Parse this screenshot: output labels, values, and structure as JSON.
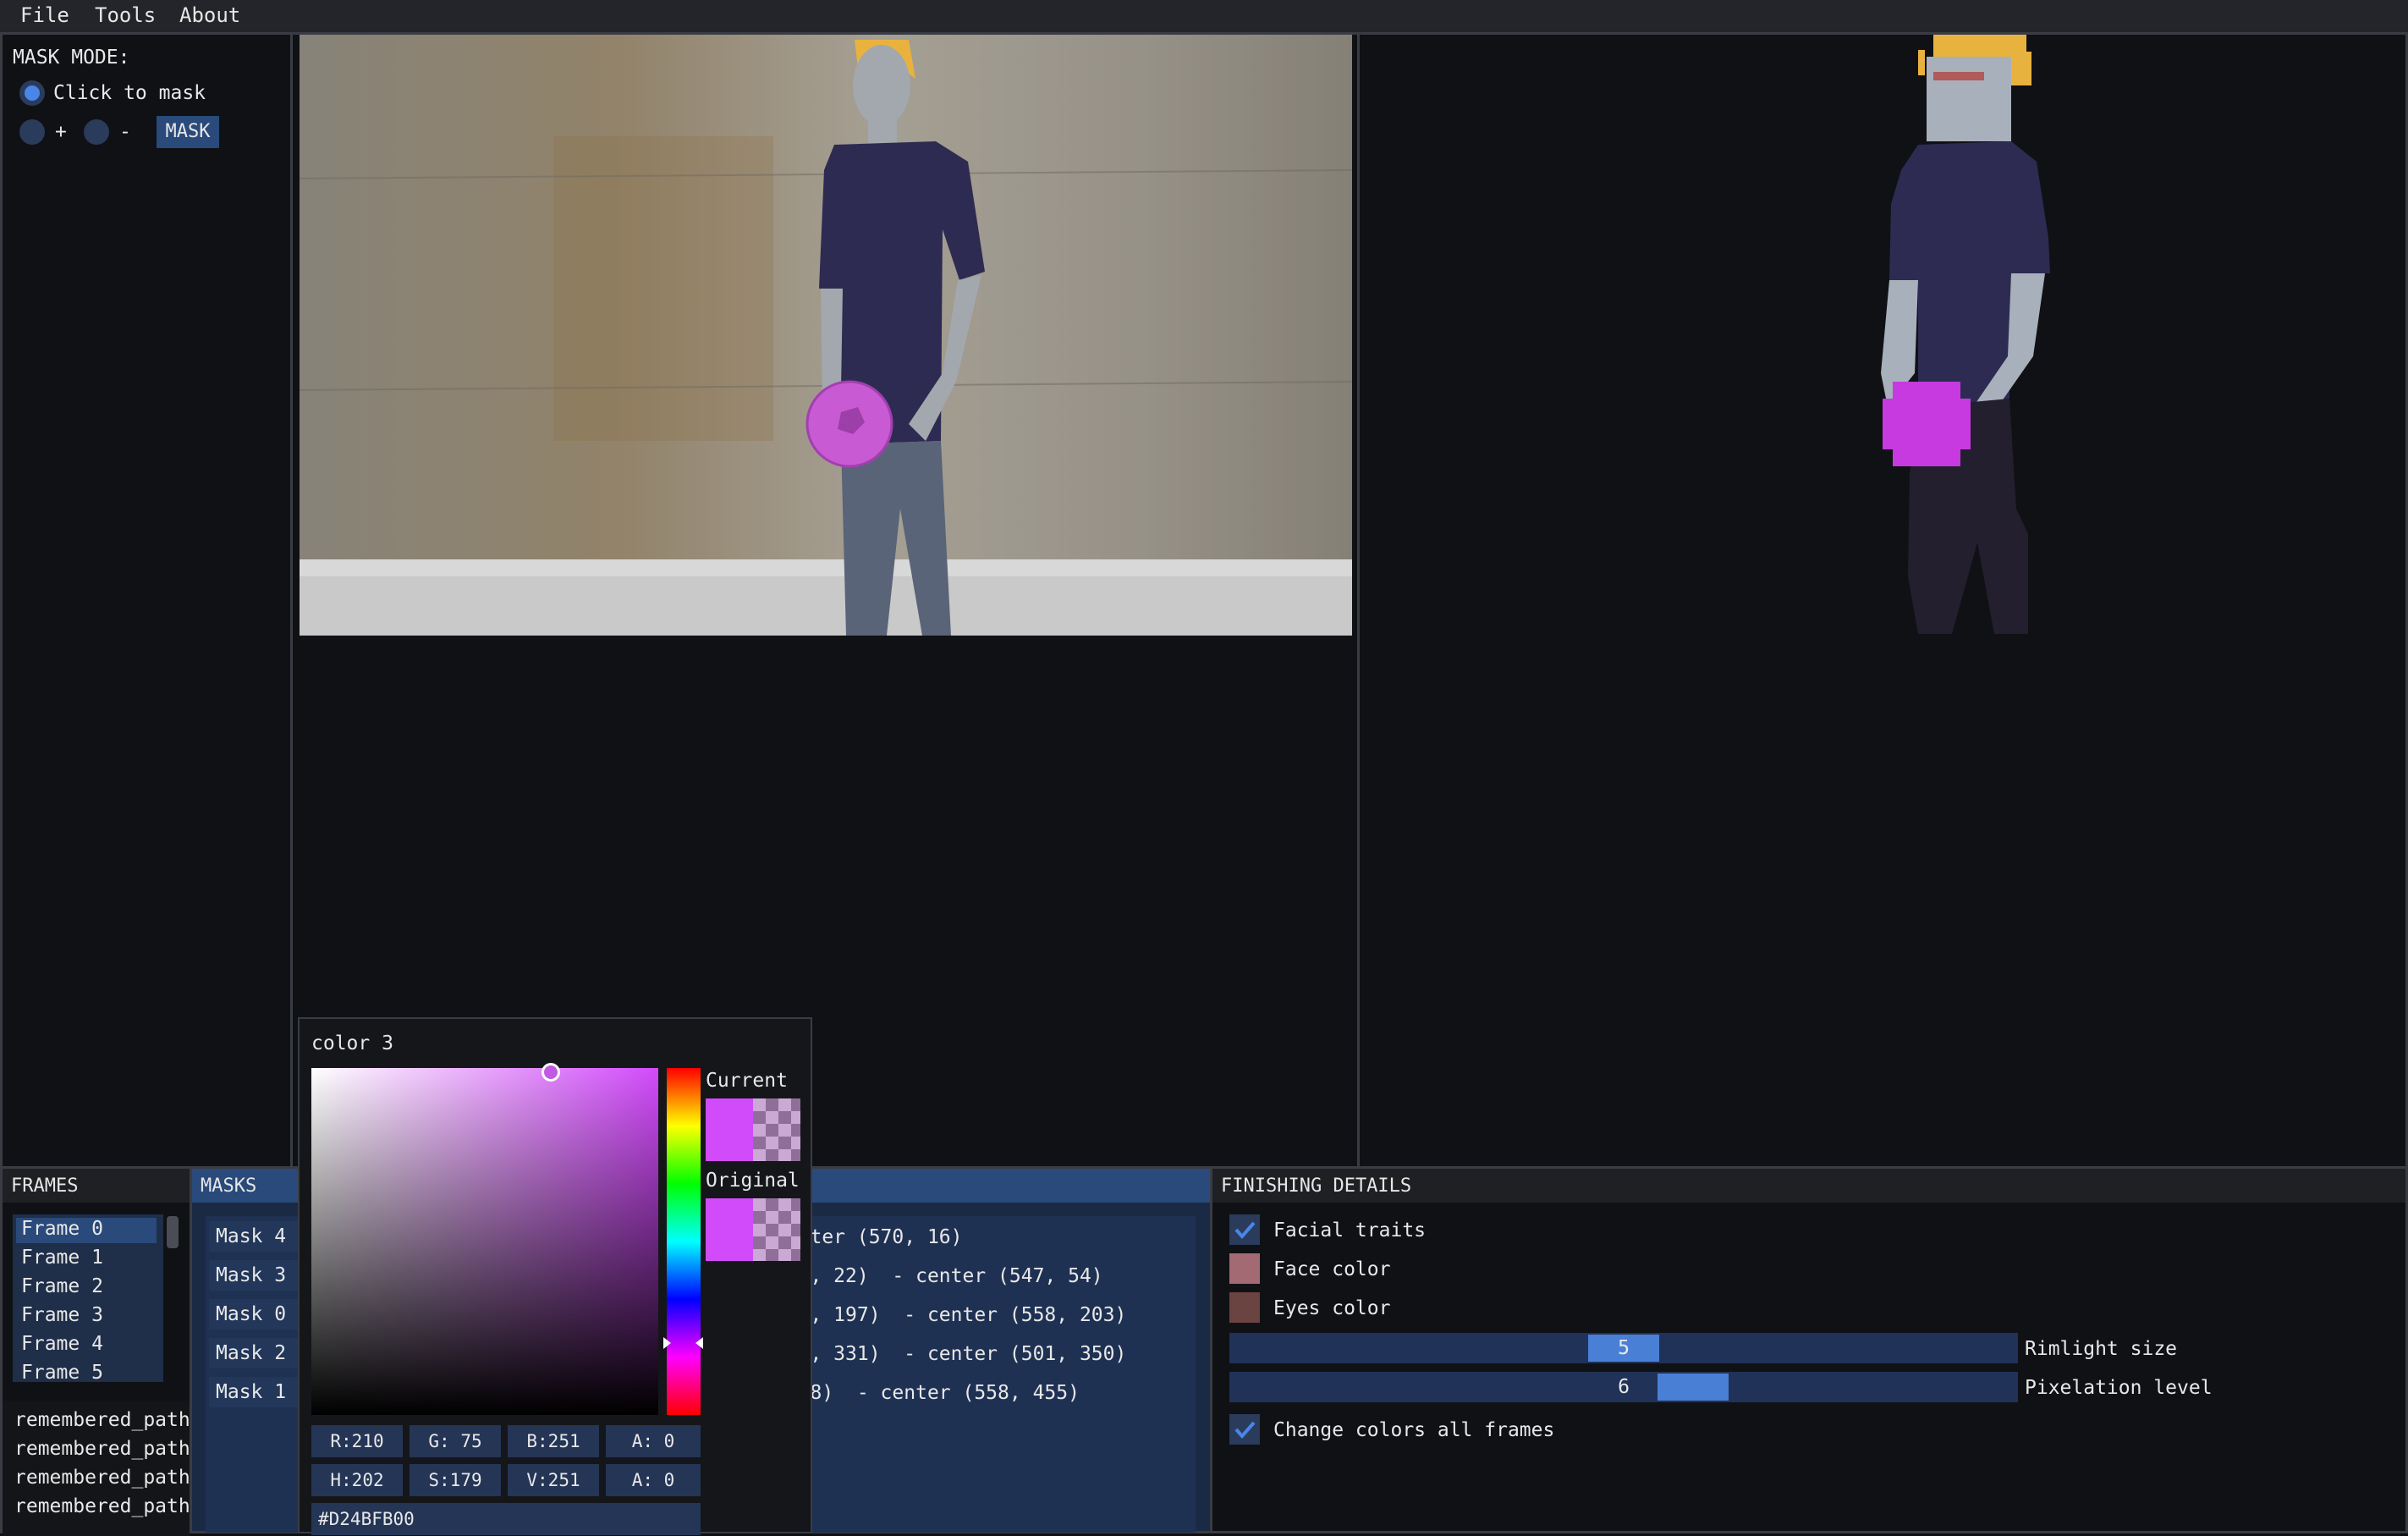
{
  "menubar": {
    "items": [
      "File",
      "Tools",
      "About"
    ]
  },
  "mask_mode": {
    "title": "MASK MODE:",
    "click_label": "Click to mask",
    "plus_label": "+",
    "minus_label": "-",
    "mask_button": "MASK"
  },
  "frames": {
    "title": "FRAMES",
    "items": [
      "Frame 0",
      "Frame 1",
      "Frame 2",
      "Frame 3",
      "Frame 4",
      "Frame 5"
    ]
  },
  "history": {
    "items": [
      "remembered_path",
      "remembered_path",
      "remembered_path",
      "remembered_path"
    ]
  },
  "masks": {
    "title": "MASKS",
    "buttons": [
      "Mask 4",
      "Mask 3",
      "Mask 0",
      "Mask 2",
      "Mask 1"
    ],
    "descriptions": [
      "25)  - center (570, 16)",
      "t  at (546, 22)  - center (547, 54)",
      "t  at (541, 197)  - center (558, 203)",
      "t  at (480, 331)  - center (501, 350)",
      "t (500, 438)  - center (558, 455)"
    ]
  },
  "color_picker": {
    "title": "color 3",
    "current_label": "Current",
    "original_label": "Original",
    "r": "R:210",
    "g": "G: 75",
    "b": "B:251",
    "a1": "A:  0",
    "h": "H:202",
    "s": "S:179",
    "v": "V:251",
    "a2": "A:  0",
    "hex": "#D24BFB00",
    "color": "#D24BFB"
  },
  "finishing": {
    "title": "FINISHING DETAILS",
    "facial_traits": "Facial traits",
    "face_color": "Face color",
    "eyes_color": "Eyes color",
    "rimlight_value": "5",
    "rimlight_label": "Rimlight size",
    "pixelation_value": "6",
    "pixelation_label": "Pixelation level",
    "change_all": "Change colors all frames",
    "face_swatch": "#a46a73",
    "eyes_swatch": "#6a4440"
  }
}
